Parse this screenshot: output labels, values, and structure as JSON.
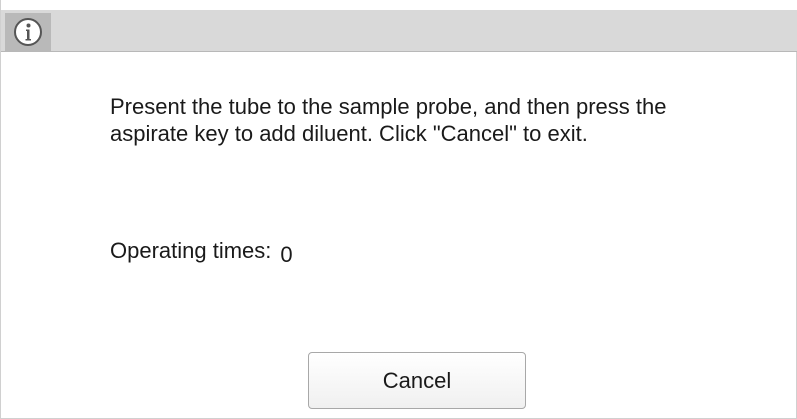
{
  "titlebar": {
    "icon": "info-icon"
  },
  "dialog": {
    "message": "Present the tube to the sample probe, and then press the aspirate key to add diluent. Click \"Cancel\" to exit.",
    "operating_times_label": "Operating times:",
    "operating_times_value": "0",
    "cancel_label": "Cancel"
  },
  "colors": {
    "titlebar_bg": "#d9d9d9",
    "icon_bg": "#b9b9b9",
    "dialog_bg": "#ffffff",
    "text": "#1a1a1a"
  }
}
